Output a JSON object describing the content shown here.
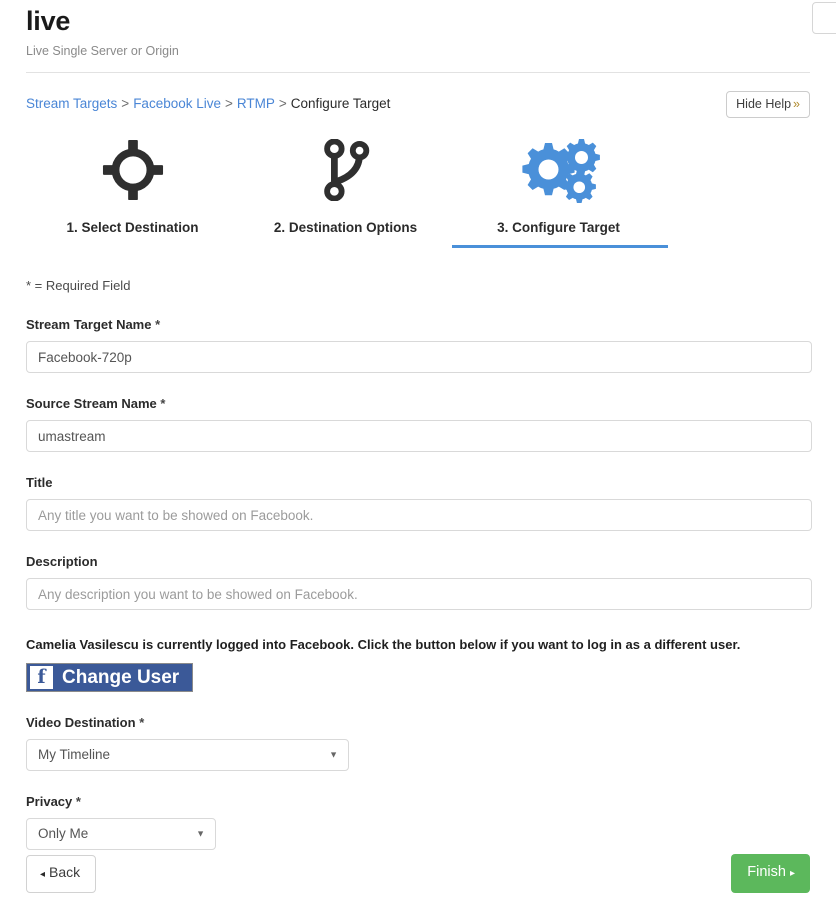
{
  "header": {
    "title": "live",
    "subtitle": "Live Single Server or Origin"
  },
  "breadcrumb": {
    "items": [
      {
        "label": "Stream Targets",
        "link": true
      },
      {
        "label": "Facebook Live",
        "link": true
      },
      {
        "label": "RTMP",
        "link": true
      },
      {
        "label": "Configure Target",
        "link": false
      }
    ],
    "separator": ">"
  },
  "help": {
    "button_label": "Hide Help",
    "chevron": "»"
  },
  "steps": [
    {
      "label": "1. Select Destination",
      "icon": "crosshair-target-icon",
      "active": false
    },
    {
      "label": "2. Destination Options",
      "icon": "code-branch-icon",
      "active": false
    },
    {
      "label": "3. Configure Target",
      "icon": "gears-icon",
      "active": true
    }
  ],
  "form": {
    "required_note": "* = Required Field",
    "required_marker": "*",
    "fields": {
      "stream_target_name": {
        "label": "Stream Target Name",
        "required": true,
        "value": "Facebook-720p",
        "placeholder": ""
      },
      "source_stream_name": {
        "label": "Source Stream Name",
        "required": true,
        "value": "umastream",
        "placeholder": ""
      },
      "title": {
        "label": "Title",
        "required": false,
        "value": "",
        "placeholder": "Any title you want to be showed on Facebook."
      },
      "description": {
        "label": "Description",
        "required": false,
        "value": "",
        "placeholder": "Any description you want to be showed on Facebook."
      },
      "video_destination": {
        "label": "Video Destination",
        "required": true,
        "selected": "My Timeline",
        "options": [
          "My Timeline"
        ]
      },
      "privacy": {
        "label": "Privacy",
        "required": true,
        "selected": "Only Me",
        "options": [
          "Only Me"
        ]
      }
    },
    "facebook": {
      "note": "Camelia Vasilescu is currently logged into Facebook. Click the button below if you want to log in as a different user.",
      "button_label": "Change User",
      "logo_glyph": "f"
    }
  },
  "footer": {
    "back_label": "Back",
    "back_arrow": "◂",
    "finish_label": "Finish",
    "finish_arrow": "▸"
  },
  "colors": {
    "link": "#4a86d6",
    "accent": "#4a90d9",
    "facebook_blue": "#3b5998",
    "finish_green": "#5cb85c"
  }
}
